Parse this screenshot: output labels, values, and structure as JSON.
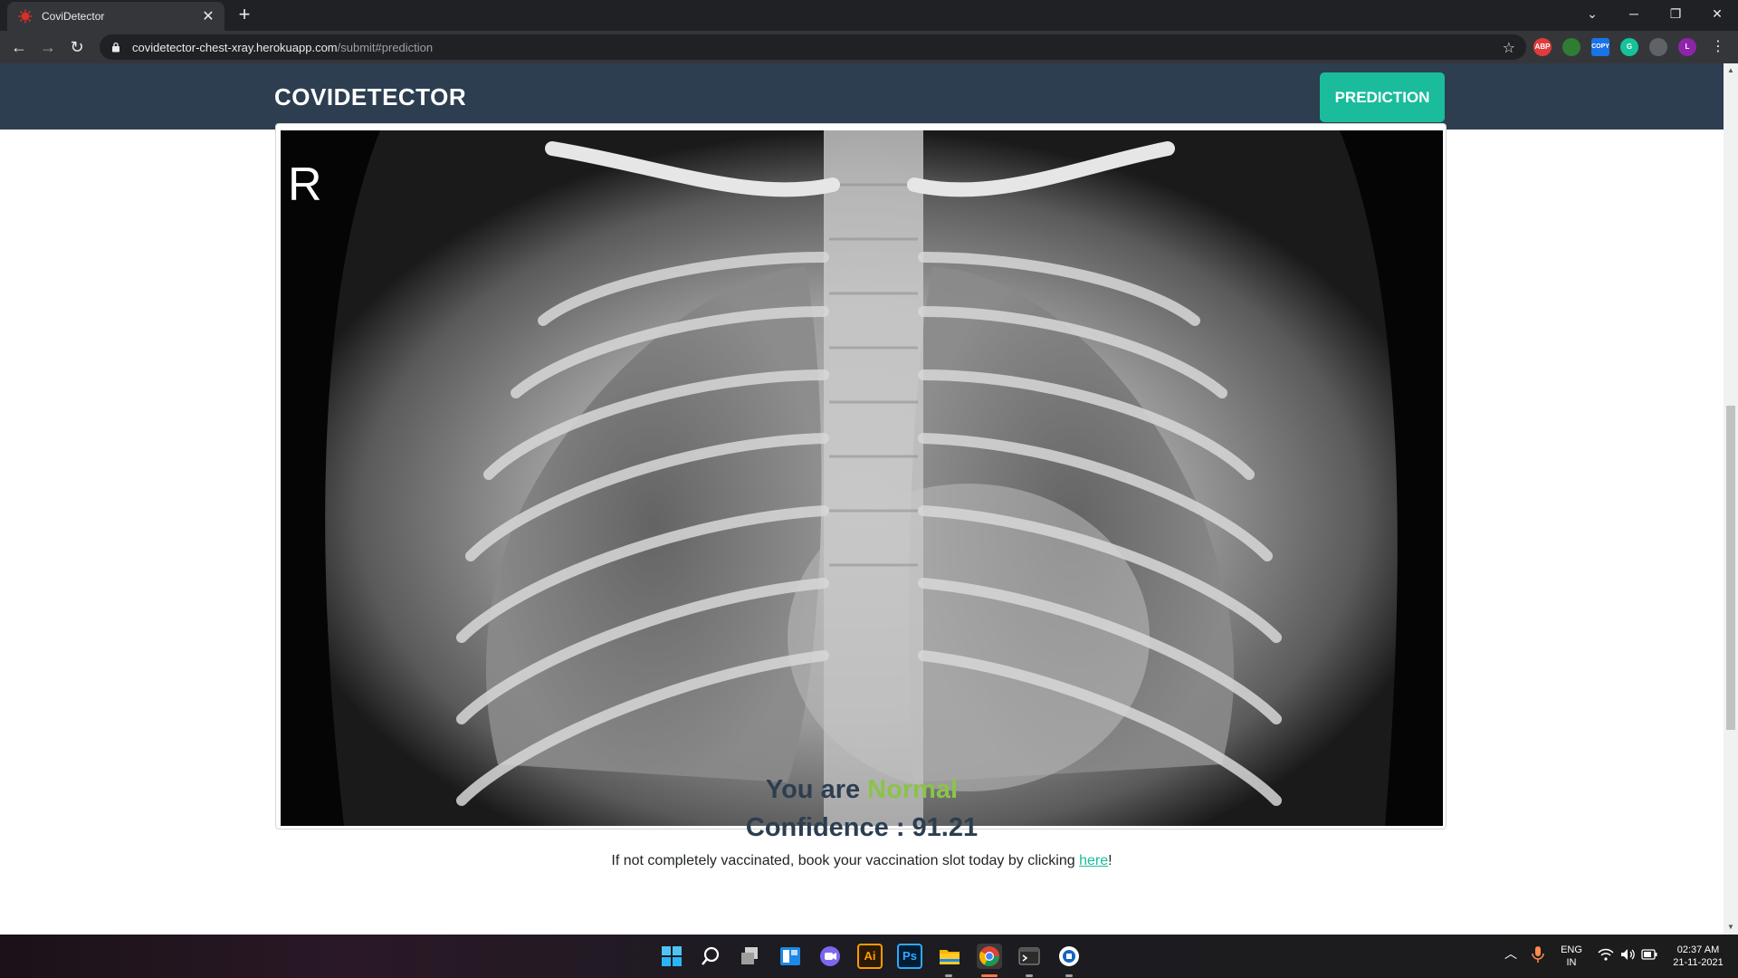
{
  "browser": {
    "tab_title": "CoviDetector",
    "url_host": "covidetector-chest-xray.herokuapp.com",
    "url_path": "/submit#prediction",
    "extensions": [
      {
        "name": "adblock-plus-icon",
        "label": "ABP",
        "color": "#e03c3c"
      },
      {
        "name": "hangouts-icon",
        "label": "",
        "color": "#2e7d32"
      },
      {
        "name": "copy-extension-icon",
        "label": "COPY",
        "color": "#1a73e8"
      },
      {
        "name": "grammarly-icon",
        "label": "G",
        "color": "#15c39a"
      },
      {
        "name": "puzzle-extensions-icon",
        "label": "",
        "color": "#5f6368"
      },
      {
        "name": "profile-avatar",
        "label": "L",
        "color": "#8e24aa"
      }
    ]
  },
  "page": {
    "brand": "COVIDETECTOR",
    "nav_button": "PREDICTION",
    "xray_marker": "R",
    "result_prefix": "You are ",
    "result_status": "Normal",
    "confidence_text": "Confidence : 91.21",
    "vax_prefix": "If not completely vaccinated, book your vaccination slot today by clicking ",
    "vax_link": "here",
    "vax_suffix": "!",
    "colors": {
      "navbar": "#2c3e50",
      "accent": "#1abc9c",
      "status_green": "#8bc34a"
    }
  },
  "taskbar": {
    "apps": [
      "start-icon",
      "search-icon",
      "task-view-icon",
      "widgets-icon",
      "teams-chat-icon",
      "illustrator-icon",
      "photoshop-icon",
      "file-explorer-icon",
      "chrome-icon",
      "terminal-icon",
      "app-icon"
    ],
    "illustrator_label": "Ai",
    "photoshop_label": "Ps",
    "lang_top": "ENG",
    "lang_bottom": "IN",
    "time": "02:37 AM",
    "date": "21-11-2021"
  }
}
